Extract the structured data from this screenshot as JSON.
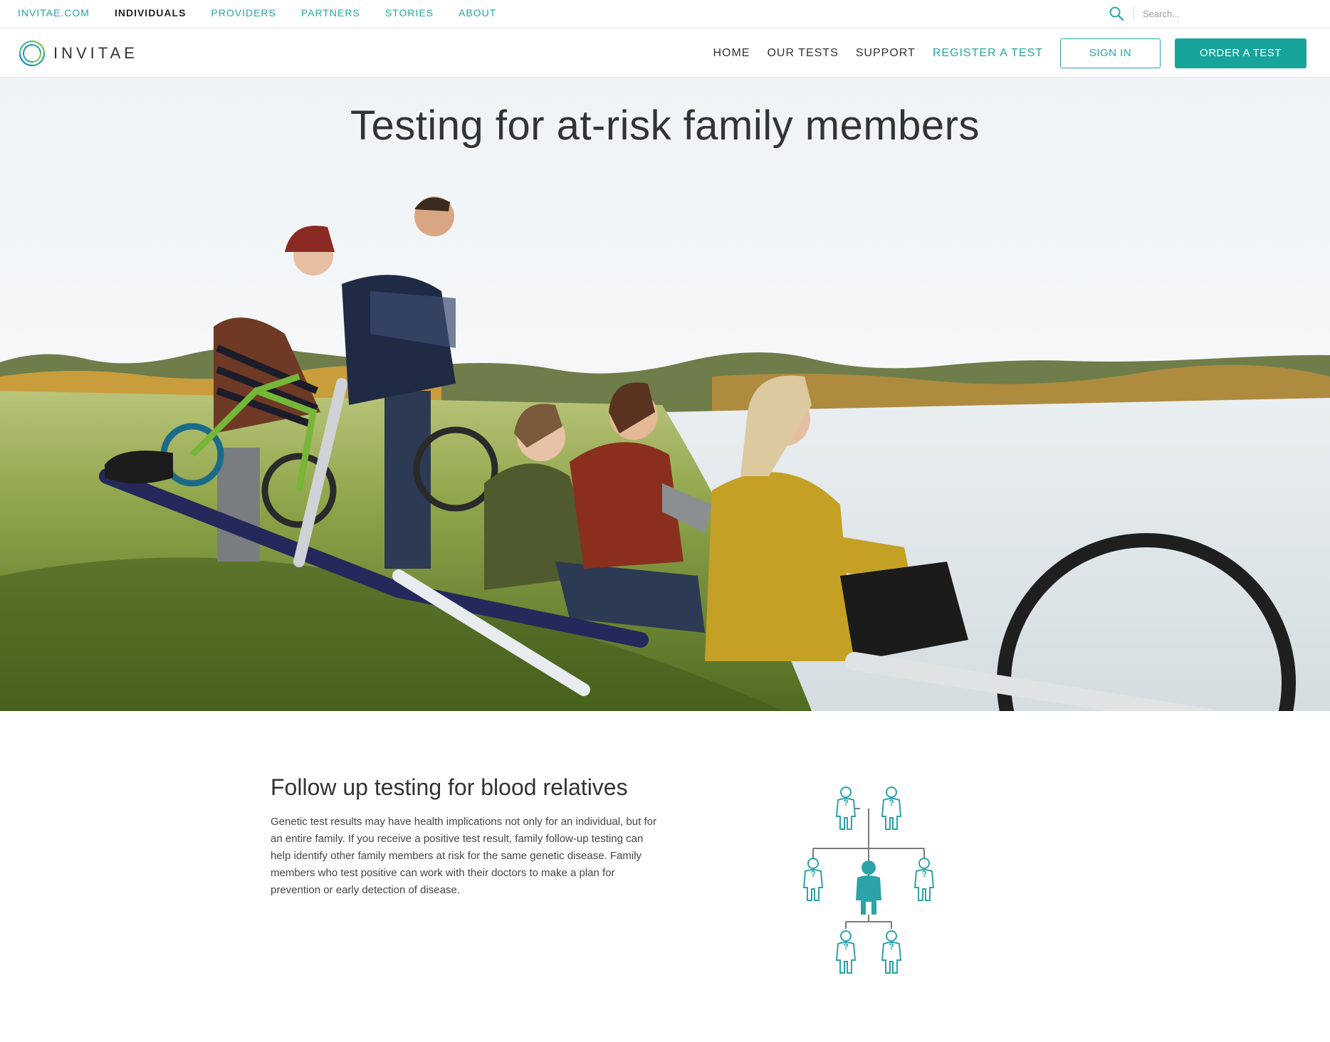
{
  "topbar": {
    "links": [
      {
        "label": "INVITAE.COM"
      },
      {
        "label": "INDIVIDUALS"
      },
      {
        "label": "PROVIDERS"
      },
      {
        "label": "PARTNERS"
      },
      {
        "label": "STORIES"
      },
      {
        "label": "ABOUT"
      }
    ],
    "active_link": "INDIVIDUALS",
    "search_placeholder": "Search..."
  },
  "brand": {
    "name": "INVITAE",
    "accent_color": "#23a6a3",
    "button_color": "#17a59b"
  },
  "nav": {
    "home": "HOME",
    "tests": "OUR TESTS",
    "support": "SUPPORT",
    "register": "REGISTER A TEST",
    "sign_in": "SIGN IN",
    "order": "ORDER A TEST"
  },
  "hero": {
    "title": "Testing for at-risk family members",
    "image": "family-with-bicycles-by-lake-photo"
  },
  "section": {
    "heading": "Follow up testing for blood relatives",
    "body": "Genetic test results may have health implications not only for an individual, but for an entire family. If you receive a positive test result, family follow-up testing can help identify other family members at risk for the same genetic disease. Family members who test positive can work with their doctors to make a plan for prevention or early detection of disease.",
    "illustration": "family-tree-icon",
    "unknown_marker": "?"
  }
}
